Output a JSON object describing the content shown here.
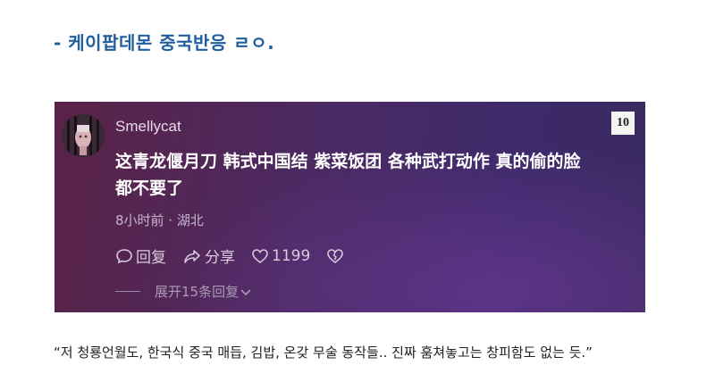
{
  "headline": "- 케이팝데몬 중국반응 ㄹㅇ.",
  "post": {
    "username": "Smellycat",
    "rank": "10",
    "comment_line1": "这青龙偃月刀 韩式中国结 紫菜饭团 各种武打动作 真的偷的脸",
    "comment_line2": "都不要了",
    "meta": "8小时前 · 湖北",
    "actions": {
      "reply_label": "回复",
      "share_label": "分享",
      "like_count": "1199"
    },
    "expand_replies": "展开15条回复"
  },
  "caption": "“저 청룡언월도, 한국식 중국 매듭, 김밥, 온갖 무술 동작들.. 진짜 훔쳐놓고는 창피함도 없는 듯.”",
  "icons": {
    "reply": "comment-bubble-icon",
    "share": "share-arrow-icon",
    "like": "heart-icon",
    "dislike": "broken-heart-icon",
    "expand": "chevron-down-icon"
  },
  "colors": {
    "headline": "#1f5f9f",
    "panel_start": "#5a2247",
    "panel_end": "#3a2a60"
  }
}
